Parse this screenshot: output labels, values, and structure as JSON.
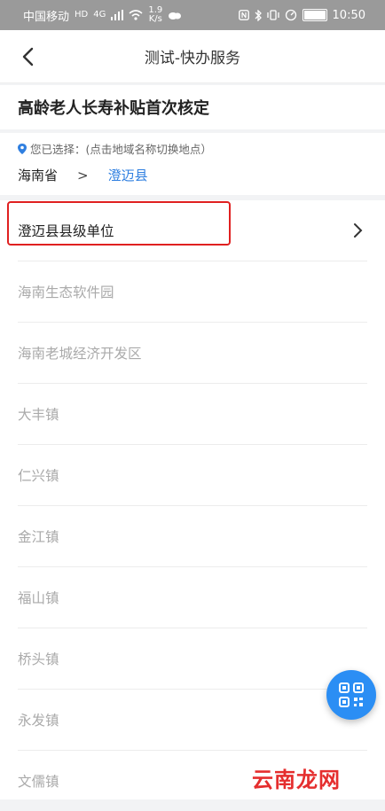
{
  "status_bar": {
    "carrier": "中国移动",
    "hd": "HD",
    "net": "4G",
    "speed_num": "1.9",
    "speed_unit": "K/s",
    "time": "10:50"
  },
  "nav": {
    "title": "测试-快办服务"
  },
  "service": {
    "title": "高龄老人长寿补贴首次核定"
  },
  "region": {
    "hint": "您已选择：(点击地域名称切换地点）",
    "province": "海南省",
    "separator": ">",
    "city": "澄迈县"
  },
  "list": {
    "items": [
      "澄迈县县级单位",
      "海南生态软件园",
      "海南老城经济开发区",
      "大丰镇",
      "仁兴镇",
      "金江镇",
      "福山镇",
      "桥头镇",
      "永发镇",
      "文儒镇"
    ]
  },
  "watermark": "云南龙网",
  "colors": {
    "accent": "#2f7fe0",
    "highlight": "#e02020",
    "fab": "#2b8ef4"
  }
}
